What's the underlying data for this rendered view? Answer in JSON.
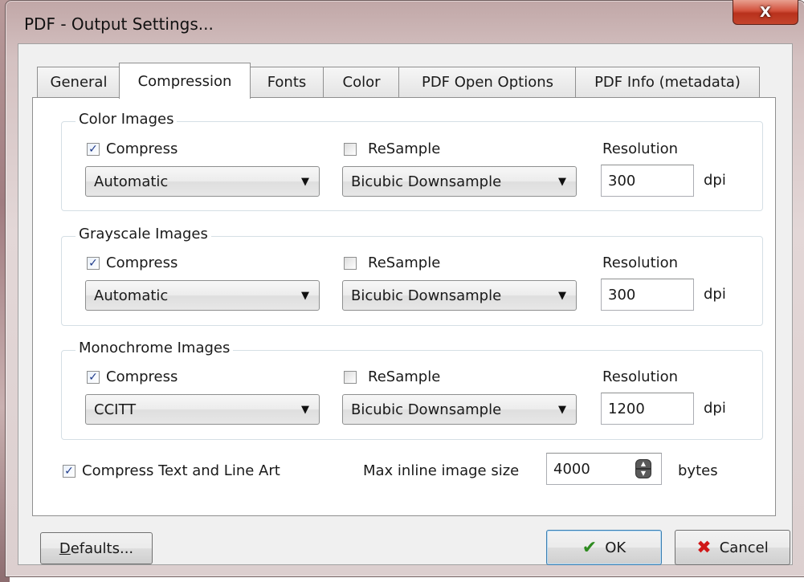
{
  "window": {
    "title": "PDF - Output Settings...",
    "close_label": "X"
  },
  "tabs": [
    {
      "label": "General"
    },
    {
      "label": "Compression",
      "active": true
    },
    {
      "label": "Fonts"
    },
    {
      "label": "Color"
    },
    {
      "label": "PDF Open Options"
    },
    {
      "label": "PDF Info (metadata)"
    }
  ],
  "groups": {
    "color": {
      "title": "Color Images",
      "compress_label": "Compress",
      "compress_checked": true,
      "method": "Automatic",
      "resample_label": "ReSample",
      "resample_checked": false,
      "resample_method": "Bicubic Downsample",
      "resolution_label": "Resolution",
      "resolution": "300",
      "unit": "dpi"
    },
    "grayscale": {
      "title": "Grayscale Images",
      "compress_label": "Compress",
      "compress_checked": true,
      "method": "Automatic",
      "resample_label": "ReSample",
      "resample_checked": false,
      "resample_method": "Bicubic Downsample",
      "resolution_label": "Resolution",
      "resolution": "300",
      "unit": "dpi"
    },
    "mono": {
      "title": "Monochrome Images",
      "compress_label": "Compress",
      "compress_checked": true,
      "method": "CCITT",
      "resample_label": "ReSample",
      "resample_checked": false,
      "resample_method": "Bicubic Downsample",
      "resolution_label": "Resolution",
      "resolution": "1200",
      "unit": "dpi"
    }
  },
  "bottom": {
    "compress_text_label": "Compress Text and Line Art",
    "compress_text_checked": true,
    "max_inline_label": "Max inline image size",
    "max_inline_value": "4000",
    "max_inline_unit": "bytes"
  },
  "buttons": {
    "defaults_label_first": "D",
    "defaults_label_rest": "efaults...",
    "ok_label": "OK",
    "cancel_label": "Cancel"
  },
  "colors": {
    "ok_check": "#2e8b20",
    "cancel_x": "#d01818",
    "checkmark": "#1e3a8a"
  },
  "icons": [
    "close-icon",
    "checkmark-icon",
    "cancel-x-icon",
    "dropdown-arrow-icon",
    "spin-updown-icon"
  ]
}
